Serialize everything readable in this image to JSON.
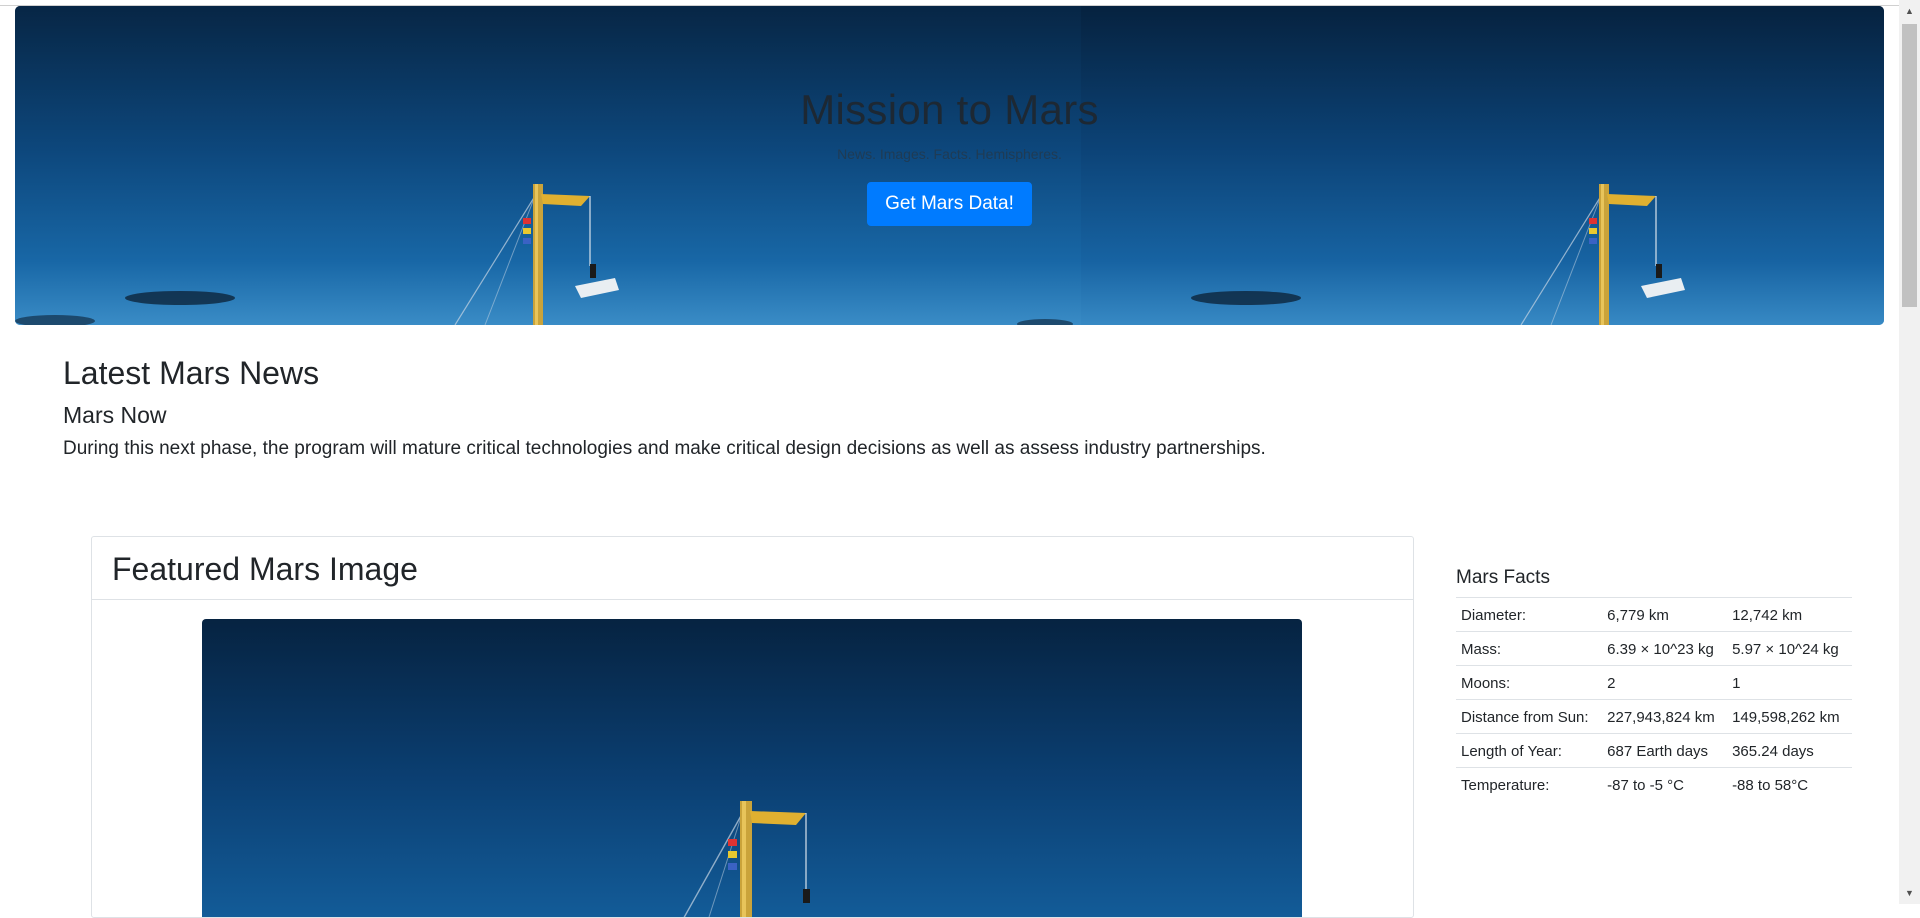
{
  "jumbotron": {
    "title": "Mission to Mars",
    "subtitle": "News. Images. Facts. Hemispheres.",
    "button_label": "Get Mars Data!"
  },
  "news": {
    "section_title": "Latest Mars News",
    "headline": "Mars Now",
    "teaser": "During this next phase, the program will mature critical technologies and make critical design decisions as well as assess industry partnerships."
  },
  "featured": {
    "title": "Featured Mars Image"
  },
  "facts": {
    "title": "Mars Facts",
    "rows": [
      {
        "label": "Diameter:",
        "mars": "6,779 km",
        "earth": "12,742 km"
      },
      {
        "label": "Mass:",
        "mars": "6.39 × 10^23 kg",
        "earth": "5.97 × 10^24 kg"
      },
      {
        "label": "Moons:",
        "mars": "2",
        "earth": "1"
      },
      {
        "label": "Distance from Sun:",
        "mars": "227,943,824 km",
        "earth": "149,598,262 km"
      },
      {
        "label": "Length of Year:",
        "mars": "687 Earth days",
        "earth": "365.24 days"
      },
      {
        "label": "Temperature:",
        "mars": "-87 to -5 °C",
        "earth": "-88 to 58°C"
      }
    ]
  },
  "colors": {
    "accent": "#007bff",
    "sky_top": "#072645",
    "sky_bottom": "#3a8cc6"
  },
  "icons": {
    "scroll_up": "▲",
    "scroll_down": "▼"
  }
}
